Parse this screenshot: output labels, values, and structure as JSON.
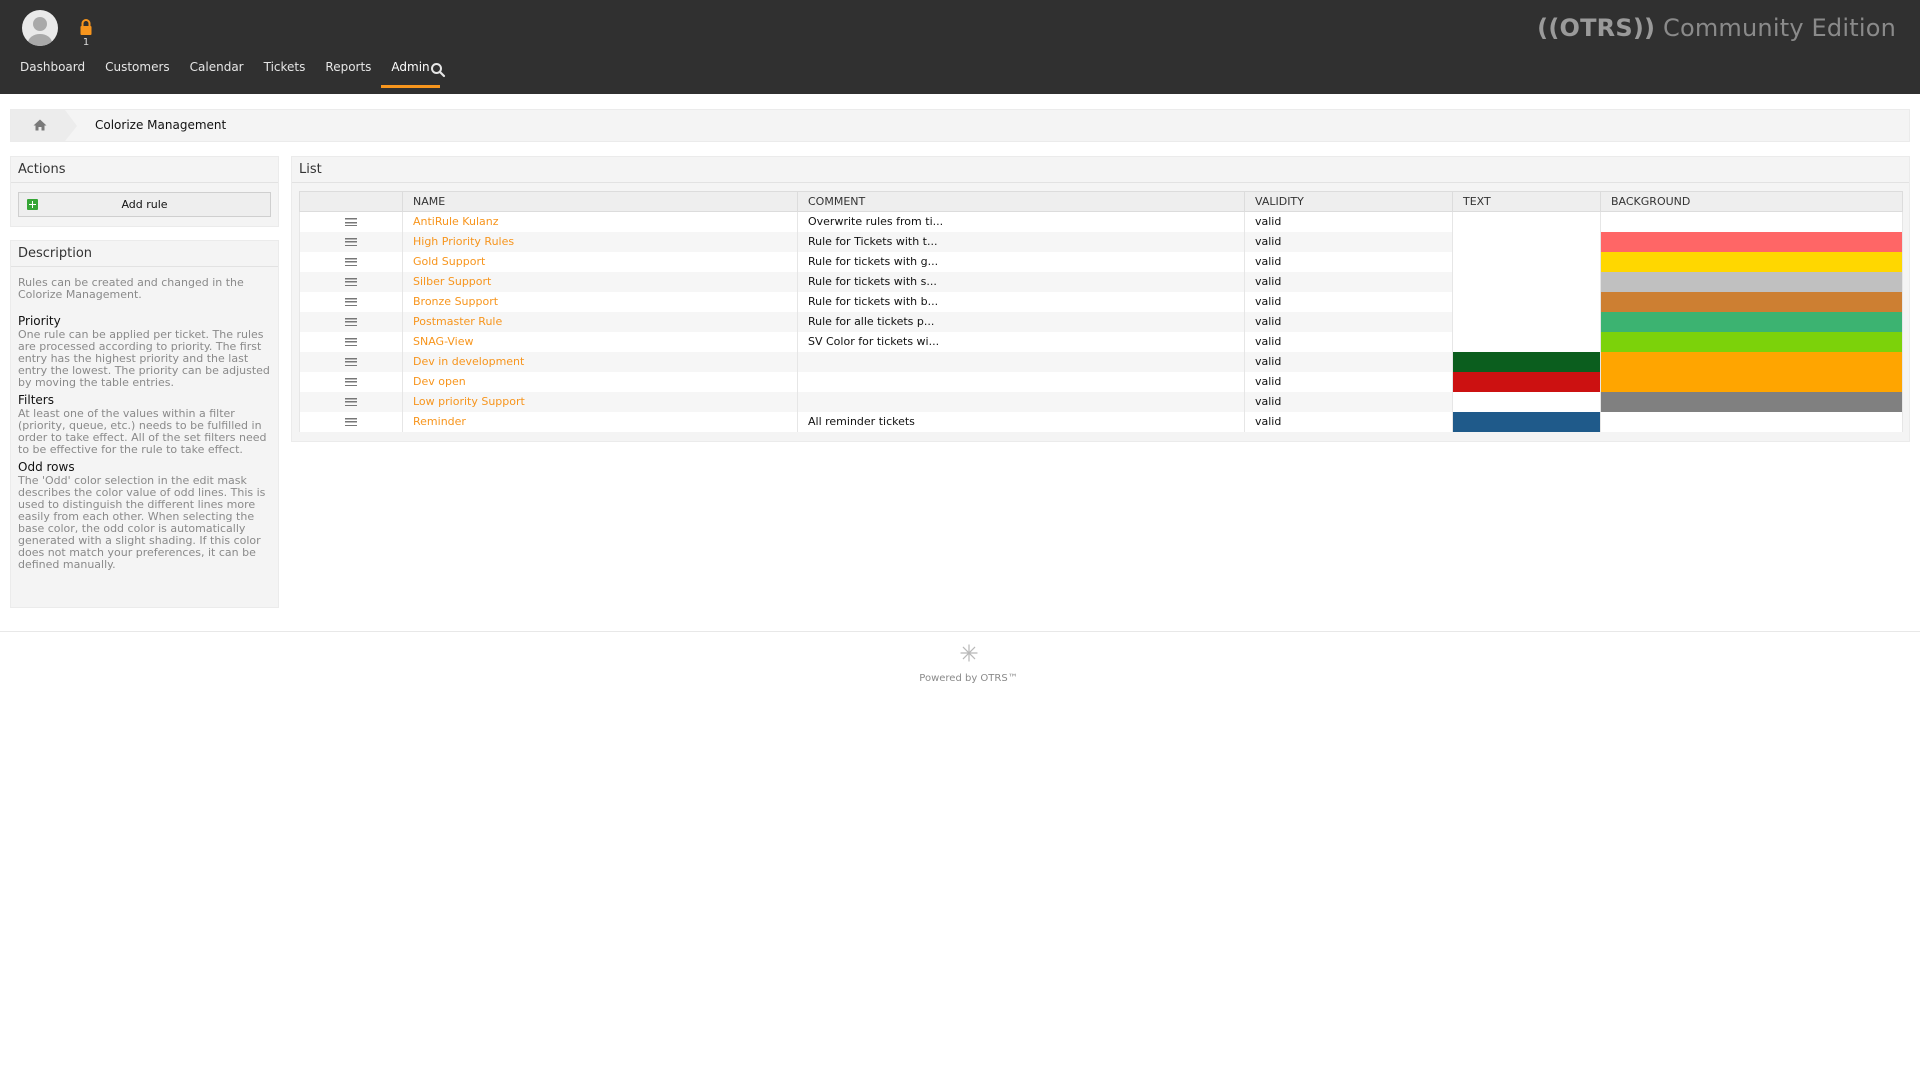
{
  "header": {
    "lock_count": "1",
    "brand_prefix": "((OTRS))",
    "brand_suffix": " Community Edition",
    "nav": [
      {
        "label": "Dashboard"
      },
      {
        "label": "Customers"
      },
      {
        "label": "Calendar"
      },
      {
        "label": "Tickets"
      },
      {
        "label": "Reports"
      },
      {
        "label": "Admin",
        "active": true
      }
    ]
  },
  "breadcrumb": {
    "current": "Colorize Management"
  },
  "actions": {
    "title": "Actions",
    "add_rule_label": "Add rule"
  },
  "description": {
    "title": "Description",
    "intro": "Rules can be created and changed in the Colorize Management.",
    "sections": [
      {
        "heading": "Priority",
        "text": "One rule can be applied per ticket. The rules are processed according to priority. The first entry has the highest priority and the last entry the lowest. The priority can be adjusted by moving the table entries."
      },
      {
        "heading": "Filters",
        "text": "At least one of the values within a filter (priority, queue, etc.) needs to be fulfilled in order to take effect. All of the set filters need to be effective for the rule to take effect."
      },
      {
        "heading": "Odd rows",
        "text": "The 'Odd' color selection in the edit mask describes the color value of odd lines. This is used to distinguish the different lines more easily from each other. When selecting the base color, the odd color is automatically generated with a slight shading. If this color does not match your preferences, it can be defined manually."
      }
    ]
  },
  "list": {
    "title": "List",
    "columns": {
      "name": "NAME",
      "comment": "COMMENT",
      "validity": "VALIDITY",
      "text": "TEXT",
      "background": "BACKGROUND"
    },
    "rows": [
      {
        "name": "AntiRule Kulanz",
        "comment": "Overwrite rules from ti...",
        "validity": "valid",
        "text_color": "transparent",
        "bg_color": "transparent"
      },
      {
        "name": "High Priority Rules",
        "comment": "Rule for Tickets with t...",
        "validity": "valid",
        "text_color": "#ffffff",
        "bg_color": "#ff6666"
      },
      {
        "name": "Gold Support",
        "comment": "Rule for tickets with g...",
        "validity": "valid",
        "text_color": "transparent",
        "bg_color": "#ffd700"
      },
      {
        "name": "Silber Support",
        "comment": "Rule for tickets with s...",
        "validity": "valid",
        "text_color": "transparent",
        "bg_color": "#c0c0c0"
      },
      {
        "name": "Bronze Support",
        "comment": "Rule for tickets with b...",
        "validity": "valid",
        "text_color": "transparent",
        "bg_color": "#cd7f32"
      },
      {
        "name": "Postmaster Rule",
        "comment": "Rule for alle tickets p...",
        "validity": "valid",
        "text_color": "transparent",
        "bg_color": "#3cb371"
      },
      {
        "name": "SNAG-View",
        "comment": "SV Color for tickets wi...",
        "validity": "valid",
        "text_color": "transparent",
        "bg_color": "#7cd20a"
      },
      {
        "name": "Dev in development",
        "comment": "",
        "validity": "valid",
        "text_color": "#0b5e1e",
        "bg_color": "#ffa500"
      },
      {
        "name": "Dev open",
        "comment": "",
        "validity": "valid",
        "text_color": "#cc1111",
        "bg_color": "#ffa500"
      },
      {
        "name": "Low priority Support",
        "comment": "",
        "validity": "valid",
        "text_color": "#ffffff",
        "bg_color": "#808080"
      },
      {
        "name": "Reminder",
        "comment": "All reminder tickets",
        "validity": "valid",
        "text_color": "#1f5a8a",
        "bg_color": "transparent"
      }
    ]
  },
  "footer": {
    "text": "Powered by OTRS™"
  },
  "colors": {
    "header_bg": "#303030",
    "accent": "#f7951d"
  },
  "icons": {
    "avatar": "user-avatar-icon",
    "lock": "lock-icon",
    "search": "search-icon",
    "home": "home-icon",
    "add": "plus-square-icon",
    "drag": "drag-handle-icon",
    "footer": "otrs-star-icon"
  }
}
